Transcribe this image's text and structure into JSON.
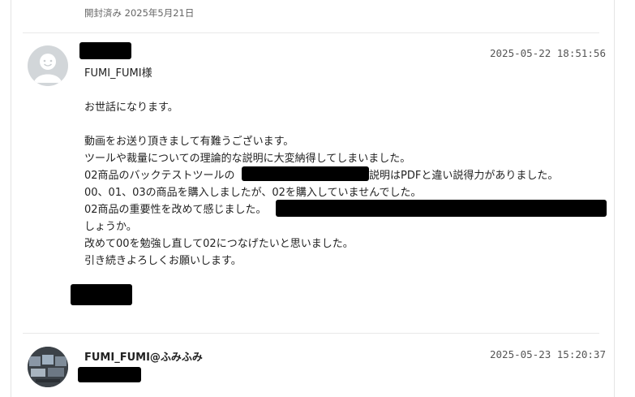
{
  "header": {
    "opened_status": "開封済み 2025年5月21日"
  },
  "message1": {
    "timestamp": "2025-05-22 18:51:56",
    "greeting": "FUMI_FUMI様",
    "opening": "お世話になります。",
    "line1": "動画をお送り頂きまして有難うございます。",
    "line2": "ツールや裁量についての理論的な説明に大変納得してしまいました。",
    "line3a": "02商品のバックテストツールの",
    "line3b": "説明はPDFと違い説得力がありました。",
    "line4": "00、01、03の商品を購入しましたが、02を購入していませんでした。",
    "line5a": "02商品の重要性を改めて感じました。",
    "line6": "しょうか。",
    "line7": "改めて00を勉強し直して02につなげたいと思いました。",
    "line8": "引き続きよろしくお願いします。"
  },
  "message2": {
    "sender": "FUMI_FUMI@ふみふみ",
    "timestamp": "2025-05-23 15:20:37"
  },
  "icons": {
    "avatar1": "default-user-avatar-icon",
    "avatar2": "user-photo-avatar"
  },
  "colors": {
    "redaction": "#000000",
    "avatar_default": "#d2d6d9"
  }
}
